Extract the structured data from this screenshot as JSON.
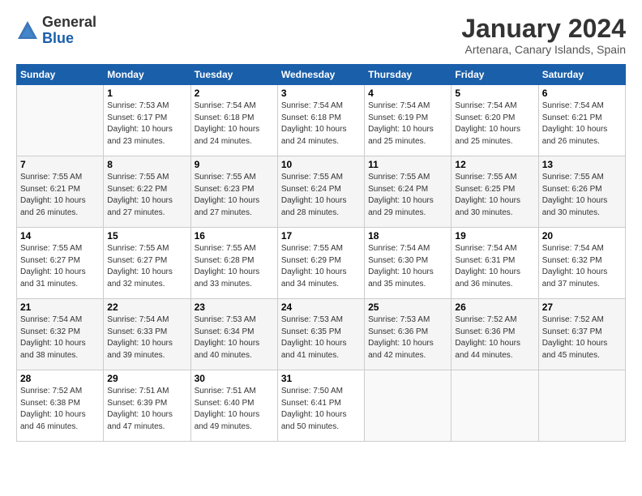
{
  "header": {
    "logo_line1": "General",
    "logo_line2": "Blue",
    "title": "January 2024",
    "subtitle": "Artenara, Canary Islands, Spain"
  },
  "days_of_week": [
    "Sunday",
    "Monday",
    "Tuesday",
    "Wednesday",
    "Thursday",
    "Friday",
    "Saturday"
  ],
  "weeks": [
    [
      {
        "day": "",
        "info": ""
      },
      {
        "day": "1",
        "info": "Sunrise: 7:53 AM\nSunset: 6:17 PM\nDaylight: 10 hours\nand 23 minutes."
      },
      {
        "day": "2",
        "info": "Sunrise: 7:54 AM\nSunset: 6:18 PM\nDaylight: 10 hours\nand 24 minutes."
      },
      {
        "day": "3",
        "info": "Sunrise: 7:54 AM\nSunset: 6:18 PM\nDaylight: 10 hours\nand 24 minutes."
      },
      {
        "day": "4",
        "info": "Sunrise: 7:54 AM\nSunset: 6:19 PM\nDaylight: 10 hours\nand 25 minutes."
      },
      {
        "day": "5",
        "info": "Sunrise: 7:54 AM\nSunset: 6:20 PM\nDaylight: 10 hours\nand 25 minutes."
      },
      {
        "day": "6",
        "info": "Sunrise: 7:54 AM\nSunset: 6:21 PM\nDaylight: 10 hours\nand 26 minutes."
      }
    ],
    [
      {
        "day": "7",
        "info": "Sunrise: 7:55 AM\nSunset: 6:21 PM\nDaylight: 10 hours\nand 26 minutes."
      },
      {
        "day": "8",
        "info": "Sunrise: 7:55 AM\nSunset: 6:22 PM\nDaylight: 10 hours\nand 27 minutes."
      },
      {
        "day": "9",
        "info": "Sunrise: 7:55 AM\nSunset: 6:23 PM\nDaylight: 10 hours\nand 27 minutes."
      },
      {
        "day": "10",
        "info": "Sunrise: 7:55 AM\nSunset: 6:24 PM\nDaylight: 10 hours\nand 28 minutes."
      },
      {
        "day": "11",
        "info": "Sunrise: 7:55 AM\nSunset: 6:24 PM\nDaylight: 10 hours\nand 29 minutes."
      },
      {
        "day": "12",
        "info": "Sunrise: 7:55 AM\nSunset: 6:25 PM\nDaylight: 10 hours\nand 30 minutes."
      },
      {
        "day": "13",
        "info": "Sunrise: 7:55 AM\nSunset: 6:26 PM\nDaylight: 10 hours\nand 30 minutes."
      }
    ],
    [
      {
        "day": "14",
        "info": "Sunrise: 7:55 AM\nSunset: 6:27 PM\nDaylight: 10 hours\nand 31 minutes."
      },
      {
        "day": "15",
        "info": "Sunrise: 7:55 AM\nSunset: 6:27 PM\nDaylight: 10 hours\nand 32 minutes."
      },
      {
        "day": "16",
        "info": "Sunrise: 7:55 AM\nSunset: 6:28 PM\nDaylight: 10 hours\nand 33 minutes."
      },
      {
        "day": "17",
        "info": "Sunrise: 7:55 AM\nSunset: 6:29 PM\nDaylight: 10 hours\nand 34 minutes."
      },
      {
        "day": "18",
        "info": "Sunrise: 7:54 AM\nSunset: 6:30 PM\nDaylight: 10 hours\nand 35 minutes."
      },
      {
        "day": "19",
        "info": "Sunrise: 7:54 AM\nSunset: 6:31 PM\nDaylight: 10 hours\nand 36 minutes."
      },
      {
        "day": "20",
        "info": "Sunrise: 7:54 AM\nSunset: 6:32 PM\nDaylight: 10 hours\nand 37 minutes."
      }
    ],
    [
      {
        "day": "21",
        "info": "Sunrise: 7:54 AM\nSunset: 6:32 PM\nDaylight: 10 hours\nand 38 minutes."
      },
      {
        "day": "22",
        "info": "Sunrise: 7:54 AM\nSunset: 6:33 PM\nDaylight: 10 hours\nand 39 minutes."
      },
      {
        "day": "23",
        "info": "Sunrise: 7:53 AM\nSunset: 6:34 PM\nDaylight: 10 hours\nand 40 minutes."
      },
      {
        "day": "24",
        "info": "Sunrise: 7:53 AM\nSunset: 6:35 PM\nDaylight: 10 hours\nand 41 minutes."
      },
      {
        "day": "25",
        "info": "Sunrise: 7:53 AM\nSunset: 6:36 PM\nDaylight: 10 hours\nand 42 minutes."
      },
      {
        "day": "26",
        "info": "Sunrise: 7:52 AM\nSunset: 6:36 PM\nDaylight: 10 hours\nand 44 minutes."
      },
      {
        "day": "27",
        "info": "Sunrise: 7:52 AM\nSunset: 6:37 PM\nDaylight: 10 hours\nand 45 minutes."
      }
    ],
    [
      {
        "day": "28",
        "info": "Sunrise: 7:52 AM\nSunset: 6:38 PM\nDaylight: 10 hours\nand 46 minutes."
      },
      {
        "day": "29",
        "info": "Sunrise: 7:51 AM\nSunset: 6:39 PM\nDaylight: 10 hours\nand 47 minutes."
      },
      {
        "day": "30",
        "info": "Sunrise: 7:51 AM\nSunset: 6:40 PM\nDaylight: 10 hours\nand 49 minutes."
      },
      {
        "day": "31",
        "info": "Sunrise: 7:50 AM\nSunset: 6:41 PM\nDaylight: 10 hours\nand 50 minutes."
      },
      {
        "day": "",
        "info": ""
      },
      {
        "day": "",
        "info": ""
      },
      {
        "day": "",
        "info": ""
      }
    ]
  ]
}
